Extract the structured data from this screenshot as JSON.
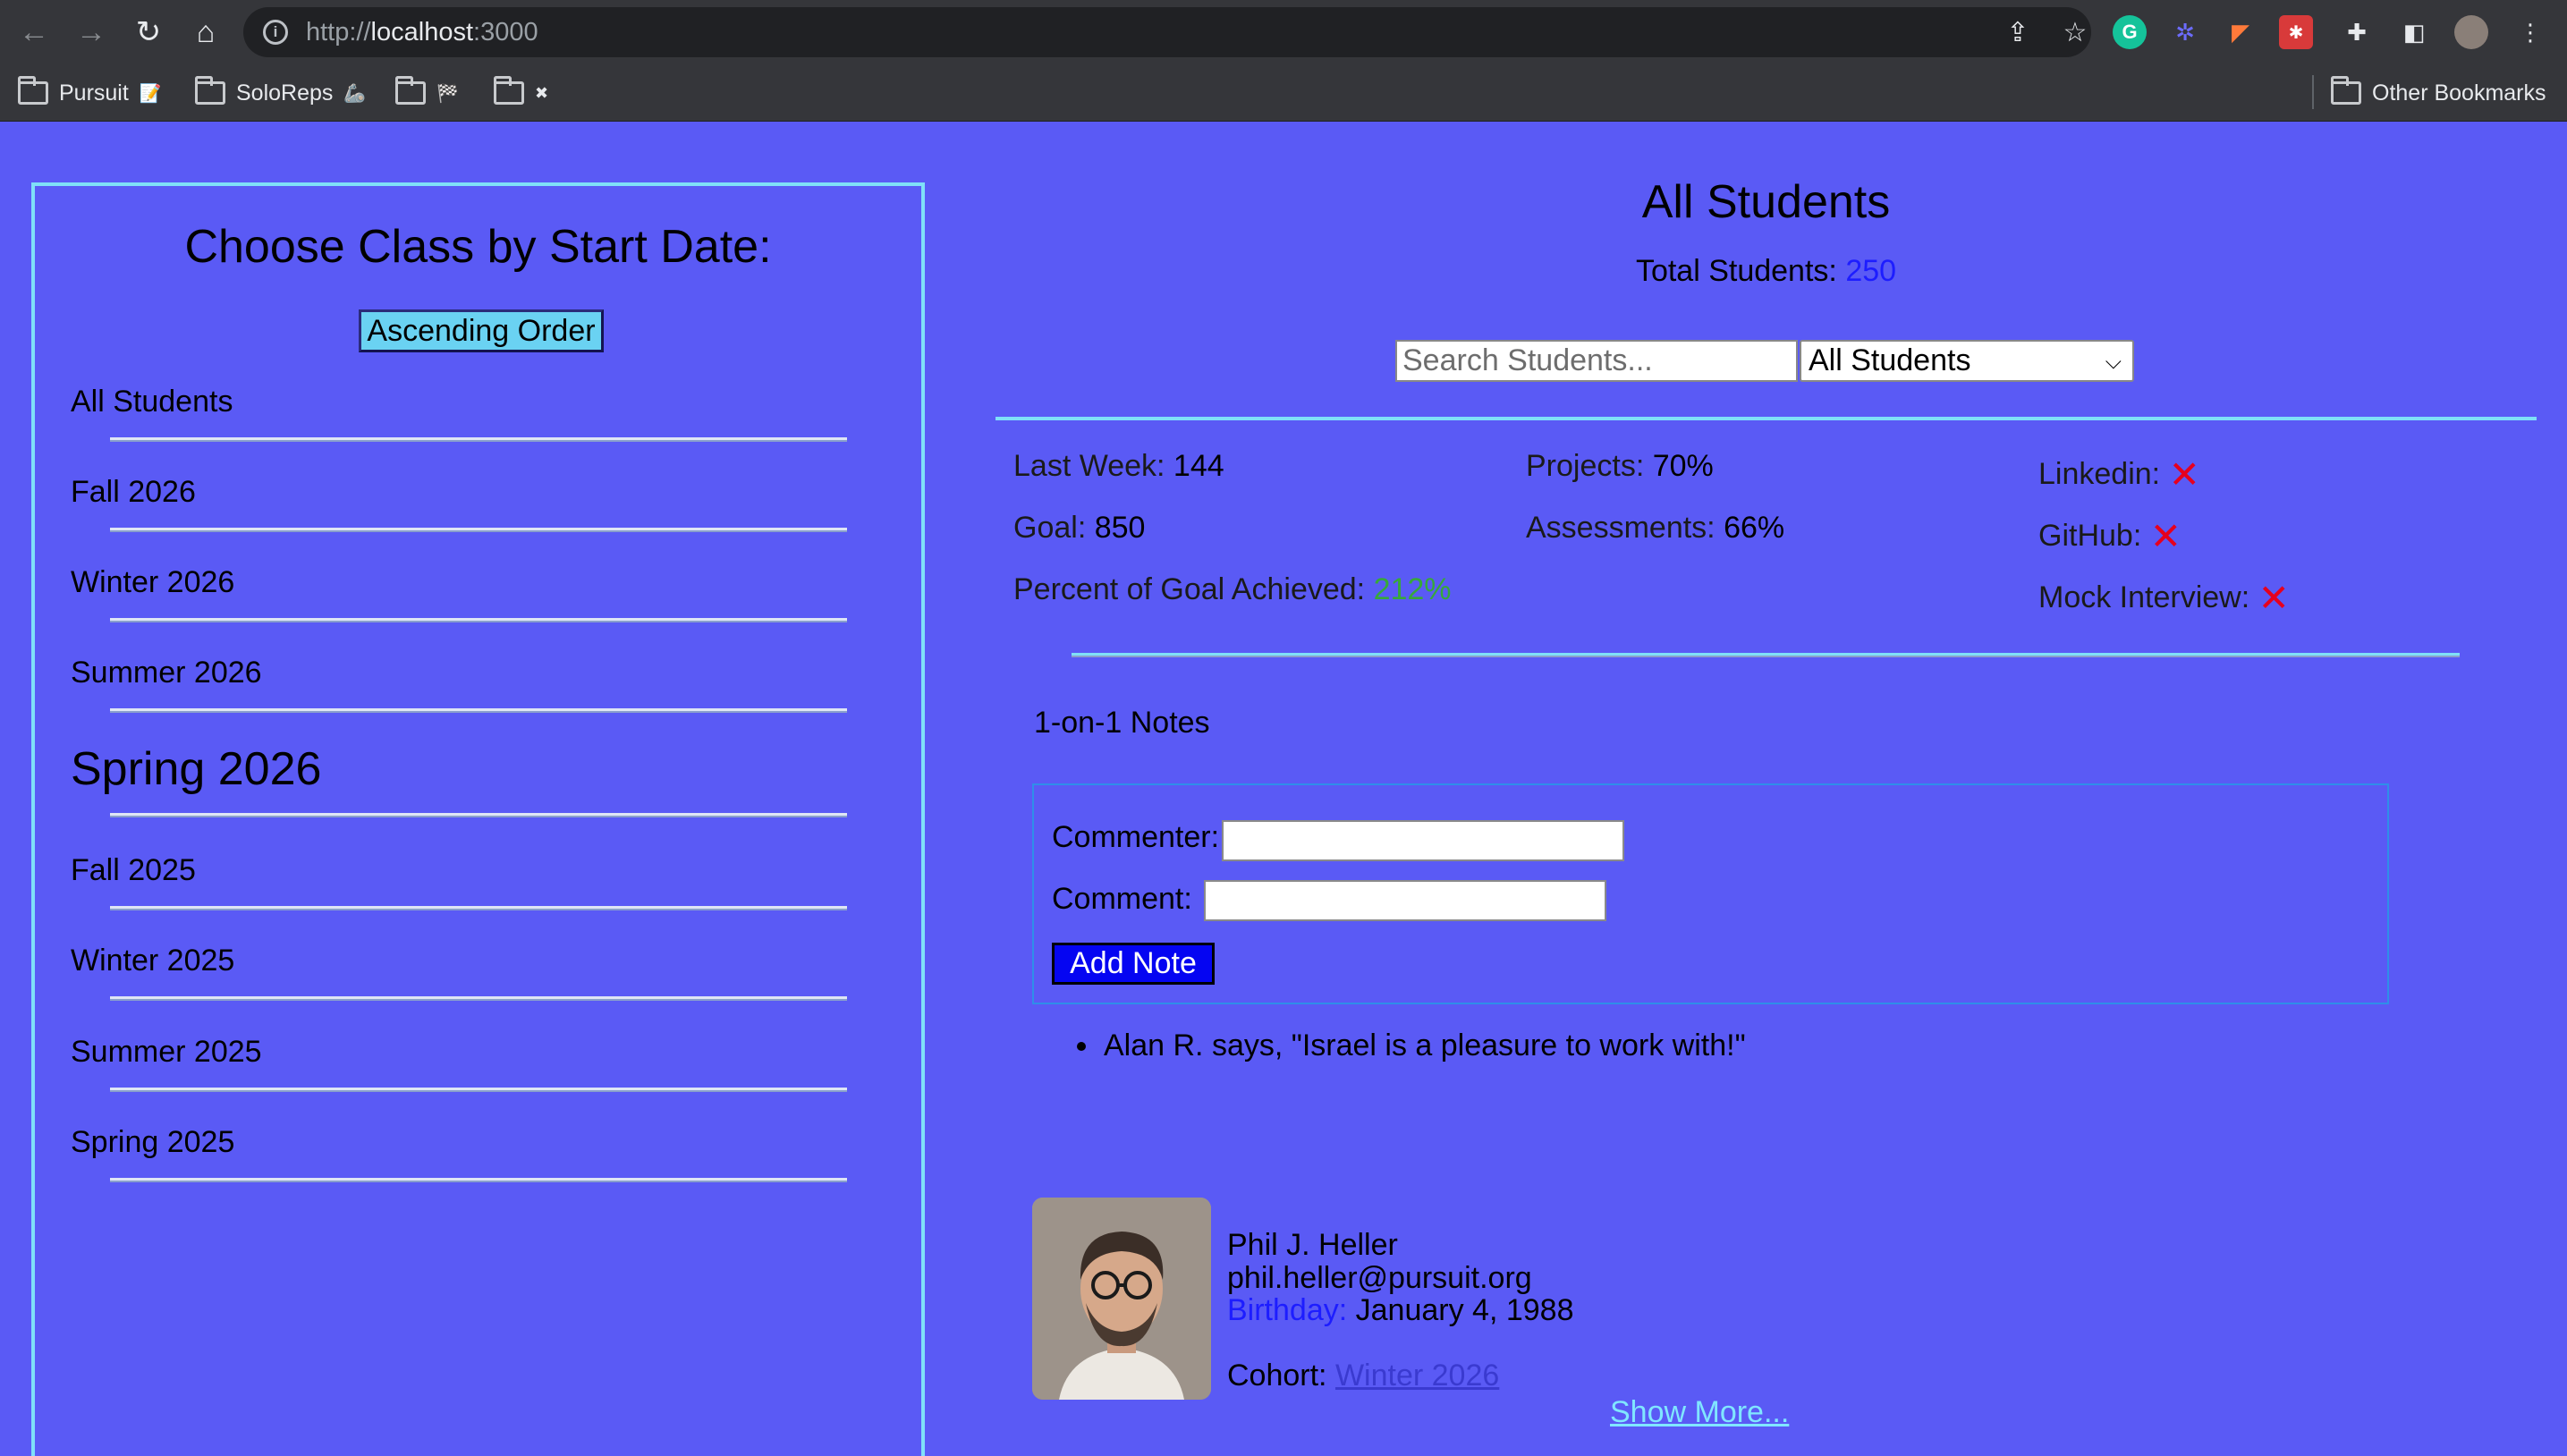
{
  "browser": {
    "url_prefix": "http://",
    "url_host": "localhost",
    "url_port": ":3000",
    "bookmarks": [
      {
        "label": "Pursuit",
        "emoji": "📝"
      },
      {
        "label": "SoloReps",
        "emoji": "🦾"
      },
      {
        "label": "",
        "emoji": "🏁"
      },
      {
        "label": "",
        "emoji": "✖"
      }
    ],
    "other_bookmarks": "Other Bookmarks"
  },
  "sidebar": {
    "title": "Choose Class by Start Date:",
    "order_button": "Ascending Order",
    "classes": [
      {
        "label": "All Students"
      },
      {
        "label": "Fall 2026"
      },
      {
        "label": "Winter 2026"
      },
      {
        "label": "Summer 2026"
      },
      {
        "label": "Spring 2026",
        "selected": true
      },
      {
        "label": "Fall 2025"
      },
      {
        "label": "Winter 2025"
      },
      {
        "label": "Summer 2025"
      },
      {
        "label": "Spring 2025"
      }
    ]
  },
  "main": {
    "title": "All Students",
    "total_label": "Total Students:",
    "total_value": "250",
    "search_placeholder": "Search Students...",
    "filter_value": "All Students"
  },
  "stats": {
    "last_week_label": "Last Week:",
    "last_week_value": "144",
    "goal_label": "Goal:",
    "goal_value": "850",
    "percent_label": "Percent of Goal Achieved:",
    "percent_value": "212%",
    "projects_label": "Projects:",
    "projects_value": "70%",
    "assessments_label": "Assessments:",
    "assessments_value": "66%",
    "linkedin_label": "Linkedin:",
    "github_label": "GitHub:",
    "mock_label": "Mock Interview:",
    "x_mark": "✕"
  },
  "notes": {
    "title": "1-on-1 Notes",
    "commenter_label": "Commenter:",
    "comment_label": "Comment:",
    "add_button": "Add Note",
    "items": [
      "Alan R. says, \"Israel is a pleasure to work with!\""
    ]
  },
  "profile": {
    "name": "Phil J. Heller",
    "email": "phil.heller@pursuit.org",
    "birthday_label": "Birthday:",
    "birthday_value": "January 4, 1988",
    "cohort_label": "Cohort:",
    "cohort_value": "Winter 2026",
    "show_more": "Show More..."
  },
  "colors": {
    "page_bg": "#5a5af5",
    "accent_line": "#7fe0f8",
    "link_blue": "#1d1dff",
    "success_green": "#37a83a",
    "fail_red": "#e6001e",
    "button_blue": "#0505f2"
  }
}
